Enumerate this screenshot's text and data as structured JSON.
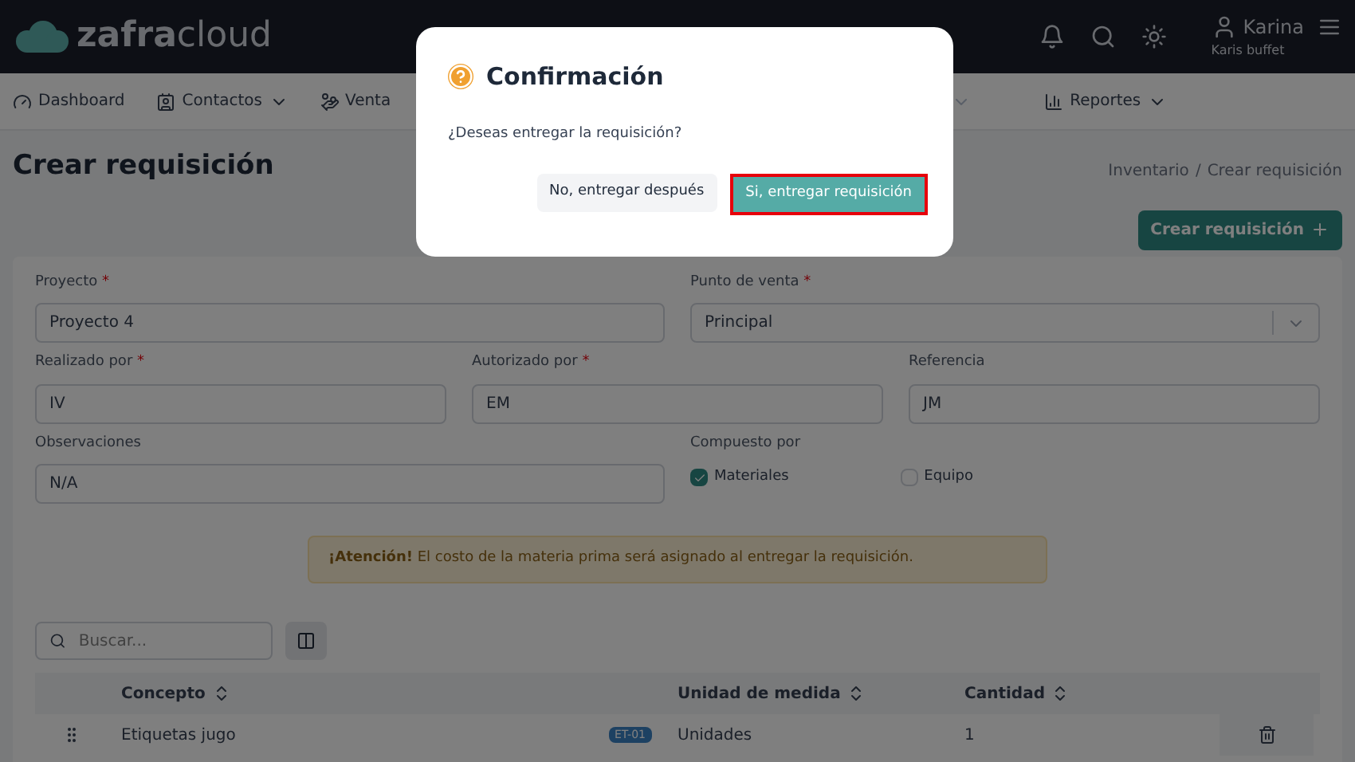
{
  "header": {
    "logo": {
      "bold": "zafra",
      "light": "cloud"
    },
    "user": {
      "name": "Karina",
      "company": "Karis buffet"
    }
  },
  "nav": [
    {
      "label": "Dashboard",
      "dropdown": false
    },
    {
      "label": "Contactos",
      "dropdown": true
    },
    {
      "label": "Venta",
      "dropdown": false
    },
    {
      "label": "Reportes",
      "dropdown": true
    }
  ],
  "page": {
    "title": "Crear requisición",
    "breadcrumb": [
      "Inventario",
      "Crear requisición"
    ],
    "breadcrumb_separator": "/",
    "create_button": "Crear requisición"
  },
  "form": {
    "required_mark": "*",
    "fields": [
      {
        "label": "Proyecto",
        "required": true,
        "value": "Proyecto 4",
        "kind": "input"
      },
      {
        "label": "Punto de venta",
        "required": true,
        "value": "Principal",
        "kind": "select"
      },
      {
        "label": "Realizado por",
        "required": true,
        "value": "IV",
        "kind": "input"
      },
      {
        "label": "Autorizado por",
        "required": true,
        "value": "EM",
        "kind": "input"
      },
      {
        "label": "Referencia",
        "required": false,
        "value": "JM",
        "kind": "input"
      },
      {
        "label": "Observaciones",
        "required": false,
        "value": "N/A",
        "kind": "textarea"
      }
    ],
    "composed_label": "Compuesto por",
    "composed": [
      {
        "label": "Materiales",
        "checked": true
      },
      {
        "label": "Equipo",
        "checked": false
      }
    ],
    "alert": "**¡Atención!** El costo de la materia prima será asignado al entregar la requisición."
  },
  "table": {
    "search_placeholder": "Buscar...",
    "columns": [
      "Concepto",
      "Unidad de medida",
      "Cantidad"
    ],
    "rows": [
      {
        "concepto": "Etiquetas jugo",
        "code": "ET-01",
        "unidad": "Unidades",
        "cantidad": "1"
      }
    ]
  },
  "dialog": {
    "title": "Confirmación",
    "message": "¿Deseas entregar la requisición?",
    "cancel": "No, entregar después",
    "confirm": "Si, entregar requisición",
    "confirm_focused": true
  }
}
